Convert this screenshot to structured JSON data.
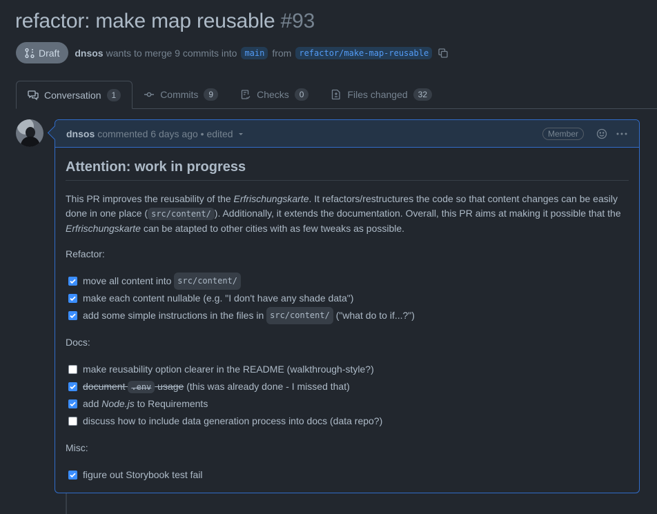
{
  "pr": {
    "title": "refactor: make map reusable",
    "number": "#93",
    "status": "Draft",
    "author": "dnsos",
    "merge_text": "wants to merge 9 commits into",
    "base_branch": "main",
    "from_text": "from",
    "head_branch": "refactor/make-map-reusable"
  },
  "tabs": [
    {
      "label": "Conversation",
      "count": "1",
      "icon": "comment-discussion-icon"
    },
    {
      "label": "Commits",
      "count": "9",
      "icon": "git-commit-icon"
    },
    {
      "label": "Checks",
      "count": "0",
      "icon": "checklist-icon"
    },
    {
      "label": "Files changed",
      "count": "32",
      "icon": "file-diff-icon"
    }
  ],
  "comment": {
    "author": "dnsos",
    "meta": "commented 6 days ago",
    "edited": "• edited",
    "role": "Member",
    "heading": "Attention: work in progress",
    "intro": {
      "t1": "This PR improves the reusability of the ",
      "em1": "Erfrischungskarte",
      "t2": ". It refactors/restructures the code so that content changes can be easily done in one place (",
      "code1": "src/content/",
      "t3": "). Additionally, it extends the documentation. Overall, this PR aims at making it possible that the ",
      "em2": "Erfrischungskarte",
      "t4": " can be atapted to other cities with as few tweaks as possible."
    },
    "refactor_heading": "Refactor:",
    "refactor_items": [
      {
        "checked": true,
        "text": "move all content into ",
        "code": "src/content/"
      },
      {
        "checked": true,
        "text": "make each content nullable (e.g. \"I don't have any shade data\")"
      },
      {
        "checked": true,
        "text": "add some simple instructions in the files in ",
        "code": "src/content/",
        "tail": " (\"what do to if...?\")"
      }
    ],
    "docs_heading": "Docs:",
    "docs_items": [
      {
        "checked": false,
        "text": "make reusability option clearer in the README (walkthrough-style?)"
      },
      {
        "checked": true,
        "strike1": "document ",
        "code": ".env",
        "strike2": " usage",
        "tail": " (this was already done - I missed that)"
      },
      {
        "checked": true,
        "text": "add ",
        "em": "Node.js",
        "tail": " to Requirements"
      },
      {
        "checked": false,
        "text": "discuss how to include data generation process into docs (data repo?)"
      }
    ],
    "misc_heading": "Misc:",
    "misc_items": [
      {
        "checked": true,
        "text": "figure out Storybook test fail"
      }
    ]
  },
  "colors": {
    "background": "#22272e",
    "accent": "#539bf5",
    "comment_border": "#316dca",
    "checkbox": "#3b8eff"
  }
}
